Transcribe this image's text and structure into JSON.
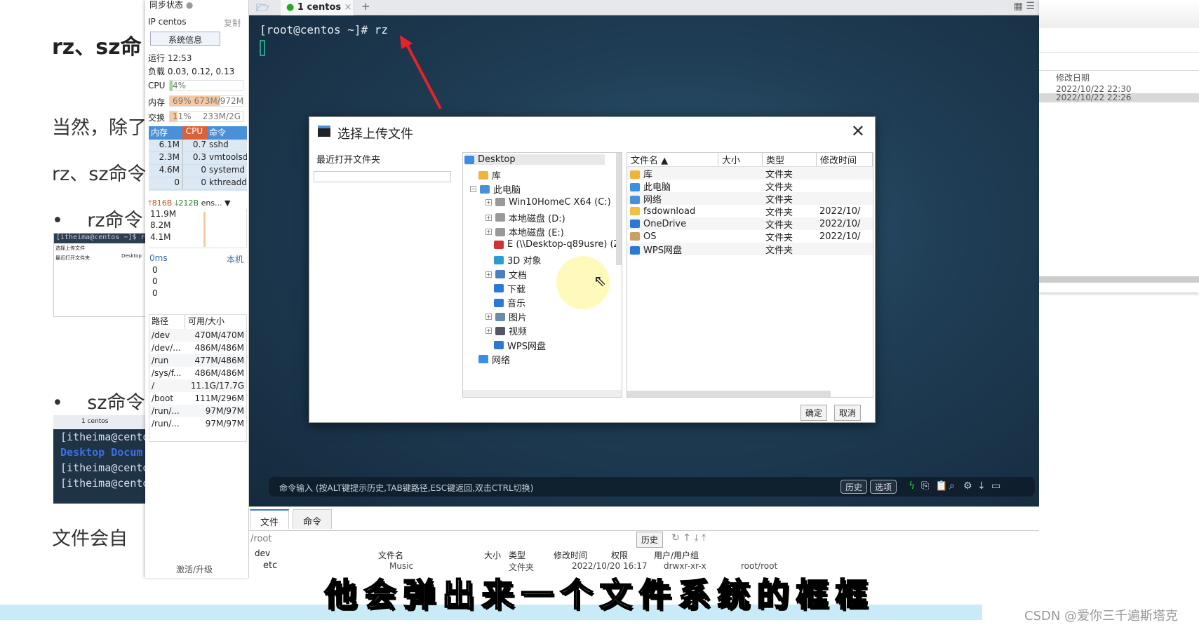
{
  "doc": {
    "heading": "rz、sz命",
    "para1": "当然，除了",
    "para2": "rz、sz命令",
    "bullet1": "rz命令",
    "bullet2": "sz命令",
    "para3": "文件会自",
    "thumb1": {
      "prompt": "[itheima@centos ~]$ rz",
      "title": "选择上传文件",
      "recent": "最近打开文件夹",
      "tree_root": "Desktop"
    },
    "thumb2": {
      "tab": "1 centos",
      "lines": [
        "[itheima@cento",
        "Desktop  Docum",
        "[itheima@cento",
        "[itheima@cento"
      ]
    }
  },
  "sidebar": {
    "sync": "同步状态",
    "ip": "IP centos",
    "copy": "复制",
    "sysinfo": "系统信息",
    "uptime": "运行 12:53",
    "load": "负载 0.03, 0.12, 0.13",
    "cpu": {
      "label": "CPU",
      "text": "4%",
      "pct": 4
    },
    "mem": {
      "label": "内存",
      "text": "69% 673M/972M",
      "pct": 69
    },
    "swap": {
      "label": "交换",
      "text": "11%",
      "size": "233M/2G",
      "pct": 11
    },
    "proc_headers": [
      "内存",
      "CPU",
      "命令"
    ],
    "procs": [
      [
        "6.1M",
        "0.7",
        "sshd"
      ],
      [
        "2.3M",
        "0.3",
        "vmtoolsd"
      ],
      [
        "4.6M",
        "0",
        "systemd"
      ],
      [
        "0",
        "0",
        "kthreadd"
      ]
    ],
    "net": {
      "up": "816B",
      "down": "212B",
      "iface": "ens...",
      "ticks": [
        "11.9M",
        "8.2M",
        "4.1M"
      ]
    },
    "ping": {
      "label": "0ms",
      "host": "本机",
      "vals": [
        "0",
        "0",
        "0"
      ]
    },
    "disk_headers": [
      "路径",
      "可用/大小"
    ],
    "disks": [
      [
        "/dev",
        "470M/470M"
      ],
      [
        "/dev/...",
        "486M/486M"
      ],
      [
        "/run",
        "477M/486M"
      ],
      [
        "/sys/f...",
        "486M/486M"
      ],
      [
        "/",
        "11.1G/17.7G"
      ],
      [
        "/boot",
        "111M/296M"
      ],
      [
        "/run/...",
        "97M/97M"
      ],
      [
        "/run/...",
        "97M/97M"
      ]
    ],
    "activate": "激活/升级"
  },
  "terminal": {
    "tab": "1 centos",
    "prompt": "[root@centos ~]# rz"
  },
  "dialog": {
    "title": "选择上传文件",
    "recent": "最近打开文件夹",
    "tree": [
      {
        "label": "Desktop",
        "lvl": 0
      },
      {
        "label": "库",
        "lvl": 1
      },
      {
        "label": "此电脑",
        "lvl": 1,
        "exp": "-"
      },
      {
        "label": "Win10HomeC X64 (C:)",
        "lvl": 2,
        "exp": "+"
      },
      {
        "label": "本地磁盘 (D:)",
        "lvl": 2,
        "exp": "+"
      },
      {
        "label": "本地磁盘 (E:)",
        "lvl": 2,
        "exp": "+"
      },
      {
        "label": "E (\\\\Desktop-q89usre) (Z",
        "lvl": 2
      },
      {
        "label": "3D 对象",
        "lvl": 2
      },
      {
        "label": "文档",
        "lvl": 2,
        "exp": "+"
      },
      {
        "label": "下载",
        "lvl": 2
      },
      {
        "label": "音乐",
        "lvl": 2
      },
      {
        "label": "图片",
        "lvl": 2,
        "exp": "+"
      },
      {
        "label": "视频",
        "lvl": 2,
        "exp": "+"
      },
      {
        "label": "WPS网盘",
        "lvl": 2
      },
      {
        "label": "网络",
        "lvl": 1
      }
    ],
    "headers": [
      "文件名",
      "大小",
      "类型",
      "修改时间"
    ],
    "files": [
      [
        "库",
        "",
        "文件夹",
        ""
      ],
      [
        "此电脑",
        "",
        "文件夹",
        ""
      ],
      [
        "网络",
        "",
        "文件夹",
        ""
      ],
      [
        "fsdownload",
        "",
        "文件夹",
        "2022/10/"
      ],
      [
        "OneDrive",
        "",
        "文件夹",
        "2022/10/"
      ],
      [
        "OS",
        "",
        "文件夹",
        "2022/10/"
      ],
      [
        "WPS网盘",
        "",
        "文件夹",
        ""
      ]
    ],
    "ok": "确定",
    "cancel": "取消"
  },
  "cmdbar": {
    "hint": "命令输入 (按ALT键提示历史,TAB键路径,ESC键返回,双击CTRL切换)",
    "history": "历史",
    "options": "选项"
  },
  "files_panel": {
    "tabs": [
      "文件",
      "命令"
    ],
    "path": "/root",
    "history": "历史",
    "tree": [
      "dev",
      "etc"
    ],
    "headers": [
      "文件名",
      "大小",
      "类型",
      "修改时间",
      "权限",
      "用户/用户组"
    ],
    "row": [
      "Music",
      "",
      "文件夹",
      "2022/10/20 16:17",
      "drwxr-xr-x",
      "root/root"
    ]
  },
  "right_window": {
    "header": "修改日期",
    "rows": [
      "2022/10/22 22:30",
      "2022/10/22 22:26"
    ]
  },
  "subtitle": "他会弹出来一个文件系统的框框",
  "watermark": "CSDN @爱你三千遍斯塔克"
}
